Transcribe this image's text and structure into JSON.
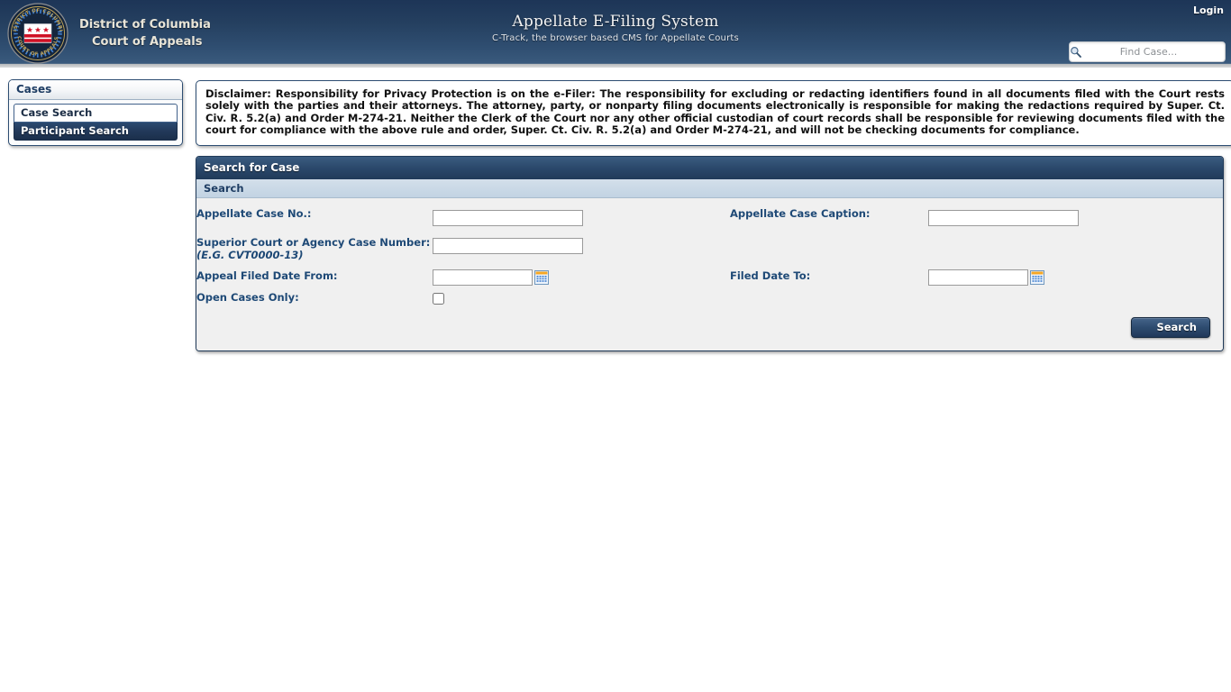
{
  "header": {
    "court_line1": "District of Columbia",
    "court_line2": "Court of Appeals",
    "title": "Appellate E-Filing System",
    "subtitle": "C-Track, the browser based CMS for Appellate Courts",
    "login_label": "Login",
    "find_case_placeholder": "Find Case...",
    "find_case_value": "",
    "search_icon": "magnifier-icon",
    "seal_outer_text_top": "DISTRICT OF COLUMBIA",
    "seal_outer_text_bottom": "COURT OF APPEALS",
    "colors": {
      "header_top": "#1d3557",
      "header_bottom": "#3a5a7d",
      "header_strip": "#d8dadb",
      "gold_text": "#e9e5d8"
    }
  },
  "sidebar": {
    "heading": "Cases",
    "items": [
      {
        "label": "Case Search",
        "selected": true
      },
      {
        "label": "Participant Search",
        "selected": false
      }
    ]
  },
  "disclaimer": {
    "text": "Disclaimer: Responsibility for Privacy Protection is on the e-Filer: The responsibility for excluding or redacting identifiers found in all documents filed with the Court rests solely with the parties and their attorneys. The attorney, party, or nonparty filing documents electronically is responsible for making the redactions required by Super. Ct. Civ. R. 5.2(a) and Order M-274-21. Neither the Clerk of the Court nor any other official custodian of court records shall be responsible for reviewing documents filed with the court for compliance with the above rule and order, Super. Ct. Civ. R. 5.2(a) and Order M-274-21, and will not be checking documents for compliance."
  },
  "panel": {
    "title": "Search for Case",
    "subtitle": "Search",
    "fields": {
      "appellate_case_no": {
        "label": "Appellate Case No.:",
        "value": "",
        "placeholder": ""
      },
      "appellate_case_caption": {
        "label": "Appellate Case Caption:",
        "value": "",
        "placeholder": ""
      },
      "superior_case_number": {
        "label": "Superior Court or Agency Case Number:",
        "hint": "(E.G. CVT0000-13)",
        "value": "",
        "placeholder": ""
      },
      "appeal_filed_date_from": {
        "label": "Appeal Filed Date From:",
        "value": "",
        "placeholder": "",
        "calendar_icon": "calendar-icon"
      },
      "filed_date_to": {
        "label": "Filed Date To:",
        "value": "",
        "placeholder": "",
        "calendar_icon": "calendar-icon"
      },
      "open_cases_only": {
        "label": "Open Cases Only:",
        "checked": false
      }
    },
    "search_button": "Search"
  }
}
